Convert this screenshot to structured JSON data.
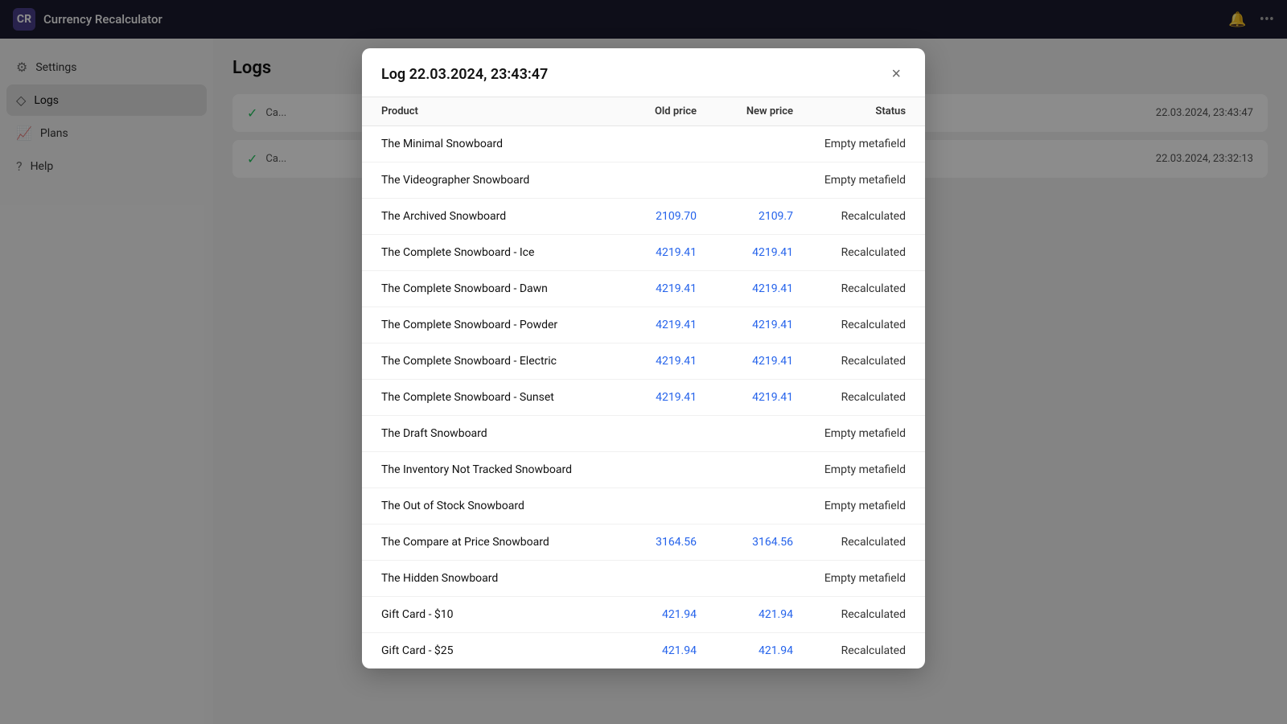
{
  "app": {
    "title": "Currency Recalculator",
    "icon_label": "CR"
  },
  "sidebar": {
    "items": [
      {
        "id": "settings",
        "label": "Settings",
        "icon": "⚙"
      },
      {
        "id": "logs",
        "label": "Logs",
        "icon": "◇",
        "active": true
      },
      {
        "id": "plans",
        "label": "Plans",
        "icon": "📈"
      },
      {
        "id": "help",
        "label": "Help",
        "icon": "?"
      }
    ]
  },
  "page": {
    "title": "Logs"
  },
  "logs_list": {
    "rows": [
      {
        "label": "Ca...",
        "date": "22.03.2024, 23:43:47"
      },
      {
        "label": "Ca...",
        "date": "22.03.2024, 23:32:13"
      }
    ]
  },
  "modal": {
    "title": "Log 22.03.2024, 23:43:47",
    "close_label": "×",
    "columns": {
      "product": "Product",
      "old_price": "Old price",
      "new_price": "New price",
      "status": "Status"
    },
    "rows": [
      {
        "product": "The Minimal Snowboard",
        "old_price": "",
        "new_price": "",
        "status": "Empty metafield"
      },
      {
        "product": "The Videographer Snowboard",
        "old_price": "",
        "new_price": "",
        "status": "Empty metafield"
      },
      {
        "product": "The Archived Snowboard",
        "old_price": "2109.70",
        "new_price": "2109.7",
        "status": "Recalculated"
      },
      {
        "product": "The Complete Snowboard - Ice",
        "old_price": "4219.41",
        "new_price": "4219.41",
        "status": "Recalculated"
      },
      {
        "product": "The Complete Snowboard - Dawn",
        "old_price": "4219.41",
        "new_price": "4219.41",
        "status": "Recalculated"
      },
      {
        "product": "The Complete Snowboard - Powder",
        "old_price": "4219.41",
        "new_price": "4219.41",
        "status": "Recalculated"
      },
      {
        "product": "The Complete Snowboard - Electric",
        "old_price": "4219.41",
        "new_price": "4219.41",
        "status": "Recalculated"
      },
      {
        "product": "The Complete Snowboard - Sunset",
        "old_price": "4219.41",
        "new_price": "4219.41",
        "status": "Recalculated"
      },
      {
        "product": "The Draft Snowboard",
        "old_price": "",
        "new_price": "",
        "status": "Empty metafield"
      },
      {
        "product": "The Inventory Not Tracked Snowboard",
        "old_price": "",
        "new_price": "",
        "status": "Empty metafield"
      },
      {
        "product": "The Out of Stock Snowboard",
        "old_price": "",
        "new_price": "",
        "status": "Empty metafield"
      },
      {
        "product": "The Compare at Price Snowboard",
        "old_price": "3164.56",
        "new_price": "3164.56",
        "status": "Recalculated"
      },
      {
        "product": "The Hidden Snowboard",
        "old_price": "",
        "new_price": "",
        "status": "Empty metafield"
      },
      {
        "product": "Gift Card - $10",
        "old_price": "421.94",
        "new_price": "421.94",
        "status": "Recalculated"
      },
      {
        "product": "Gift Card - $25",
        "old_price": "421.94",
        "new_price": "421.94",
        "status": "Recalculated"
      }
    ]
  }
}
